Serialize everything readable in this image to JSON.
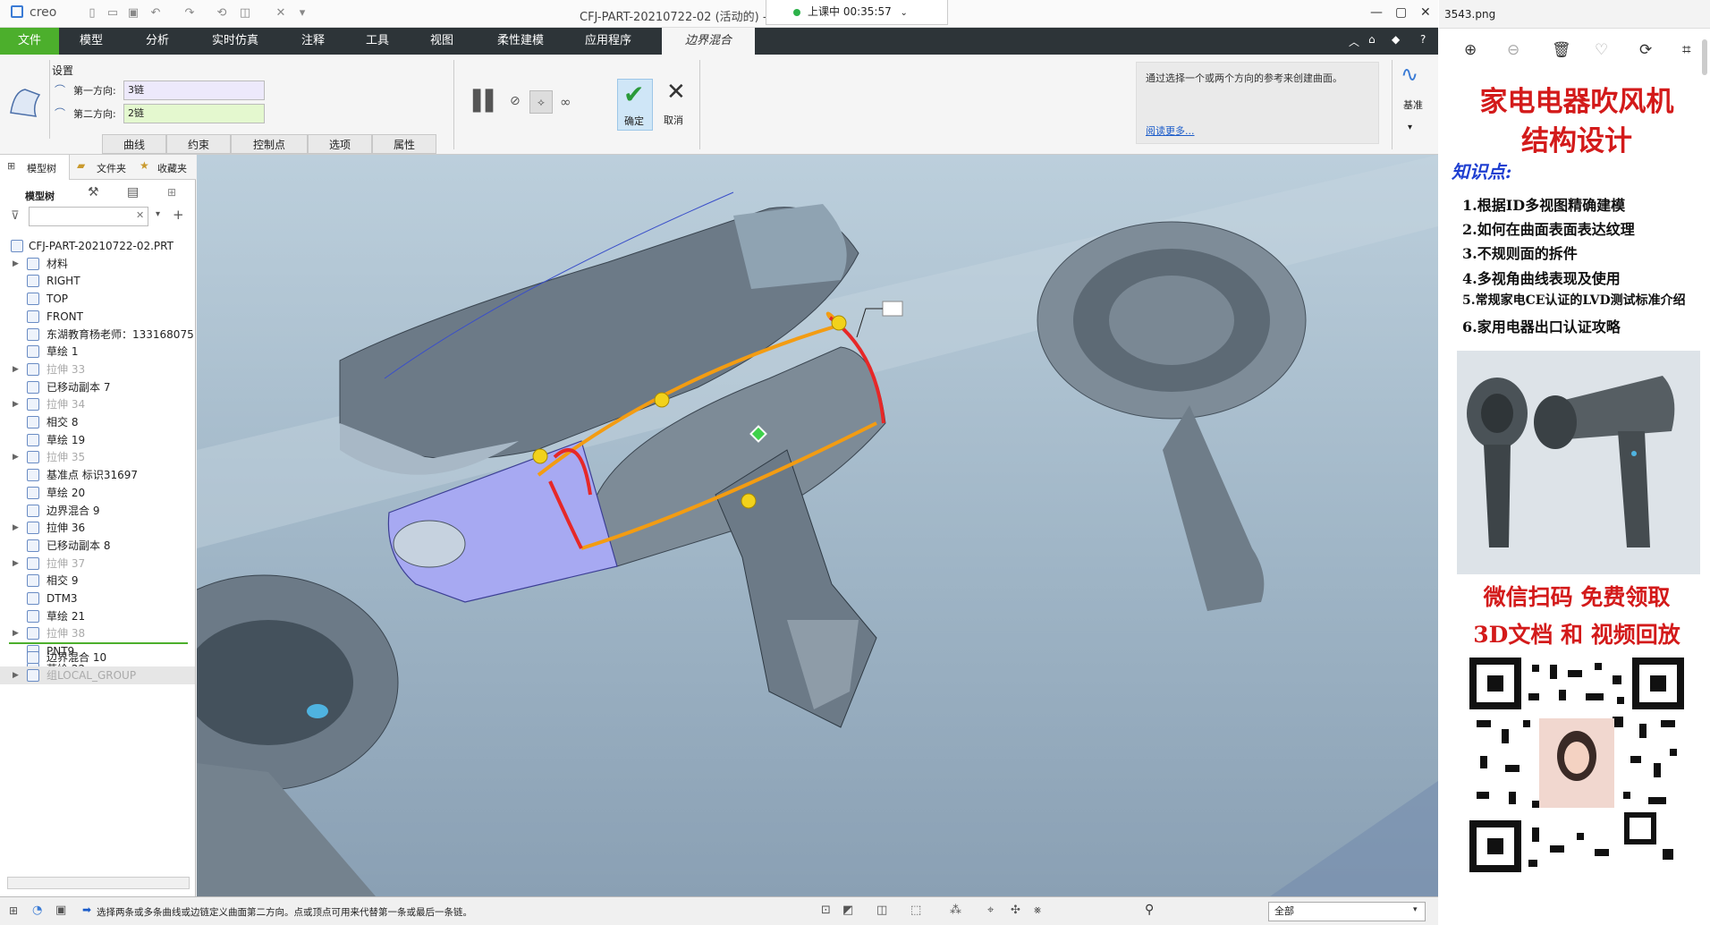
{
  "window": {
    "app_logo": "creo",
    "title": "CFJ-PART-20210722-02 (活动的) - ",
    "timer": "上课中 00:35:57",
    "timer_status_color": "#2db24a"
  },
  "tabs": [
    "文件",
    "模型",
    "分析",
    "实时仿真",
    "注释",
    "工具",
    "视图",
    "柔性建模",
    "应用程序",
    "边界混合"
  ],
  "ribbon": {
    "settings_label": "设置",
    "dir1_label": "第一方向:",
    "dir1_value": "3链",
    "dir2_label": "第二方向:",
    "dir2_value": "2链",
    "subtabs": [
      "曲线",
      "约束",
      "控制点",
      "选项",
      "属性"
    ],
    "ok_label": "确定",
    "cancel_label": "取消",
    "help_text": "通过选择一个或两个方向的参考来创建曲面。",
    "help_link": "阅读更多...",
    "datum_label": "基准"
  },
  "panel": {
    "tabs": [
      "模型树",
      "文件夹",
      "收藏夹"
    ],
    "tree_label": "模型树",
    "search_placeholder": ""
  },
  "tree": [
    {
      "label": "CFJ-PART-20210722-02.PRT",
      "arrow": "",
      "dim": false
    },
    {
      "label": "材料",
      "arrow": "▶",
      "dim": false
    },
    {
      "label": "RIGHT",
      "arrow": "",
      "dim": false
    },
    {
      "label": "TOP",
      "arrow": "",
      "dim": false
    },
    {
      "label": "FRONT",
      "arrow": "",
      "dim": false
    },
    {
      "label": "东湖教育杨老师：133168075",
      "arrow": "",
      "dim": false
    },
    {
      "label": "草绘 1",
      "arrow": "",
      "dim": false
    },
    {
      "label": "拉伸 33",
      "arrow": "▶",
      "dim": true
    },
    {
      "label": "已移动副本 7",
      "arrow": "",
      "dim": false
    },
    {
      "label": "拉伸 34",
      "arrow": "▶",
      "dim": true
    },
    {
      "label": "相交 8",
      "arrow": "",
      "dim": false
    },
    {
      "label": "草绘 19",
      "arrow": "",
      "dim": false
    },
    {
      "label": "拉伸 35",
      "arrow": "▶",
      "dim": true
    },
    {
      "label": "基准点 标识31697",
      "arrow": "",
      "dim": false
    },
    {
      "label": "草绘 20",
      "arrow": "",
      "dim": false
    },
    {
      "label": "边界混合 9",
      "arrow": "",
      "dim": false
    },
    {
      "label": "拉伸 36",
      "arrow": "▶",
      "dim": false
    },
    {
      "label": "已移动副本 8",
      "arrow": "",
      "dim": false
    },
    {
      "label": "拉伸 37",
      "arrow": "▶",
      "dim": true
    },
    {
      "label": "相交 9",
      "arrow": "",
      "dim": false
    },
    {
      "label": "DTM3",
      "arrow": "",
      "dim": false
    },
    {
      "label": "草绘 21",
      "arrow": "",
      "dim": false
    },
    {
      "label": "拉伸 38",
      "arrow": "▶",
      "dim": true
    },
    {
      "label": "PNT9",
      "arrow": "",
      "dim": false
    },
    {
      "label": "草绘 22",
      "arrow": "",
      "dim": false
    }
  ],
  "tree_after": [
    {
      "label": "边界混合 10",
      "arrow": "",
      "dim": false
    },
    {
      "label": "组LOCAL_GROUP",
      "arrow": "▶",
      "dim": true
    }
  ],
  "status": {
    "message": "选择两条或多条曲线或边链定义曲面第二方向。点或顶点可用来代替第一条或最后一条链。",
    "filter_value": "全部"
  },
  "viewer": {
    "filename": "3543.png",
    "poster": {
      "title_line1": "家电电器吹风机",
      "title_line2": "结构设计",
      "knowledge_label": "知识点:",
      "items": [
        "1.根据ID多视图精确建模",
        "2.如何在曲面表面表达纹理",
        "3.不规则面的拆件",
        "4.多视角曲线表现及使用",
        "5.常规家电CE认证的LVD测试标准介绍",
        "6.家用电器出口认证攻略"
      ],
      "cta_line1": "微信扫码 免费领取",
      "cta_line2": "3D文档 和 视频回放",
      "title_color": "#d31a1a",
      "knowledge_color": "#1f3fd1"
    }
  }
}
